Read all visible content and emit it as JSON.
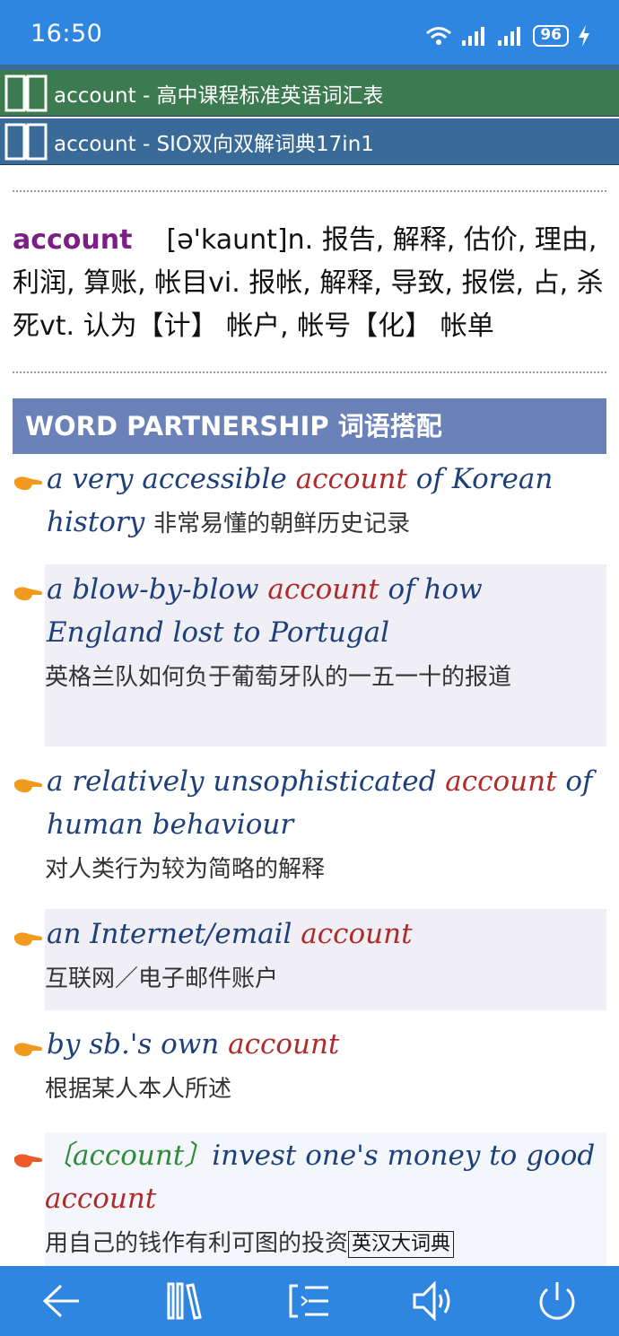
{
  "status": {
    "time": "16:50",
    "battery": "96"
  },
  "sources": [
    {
      "label": "account - 高中课程标准英语词汇表",
      "color": "#3c7a50"
    },
    {
      "label": "account - SIO双向双解词典17in1",
      "color": "#3a6b98"
    }
  ],
  "entry": {
    "headword": "account",
    "definition": "[ə'kaunt]n. 报告, 解释, 估价, 理由, 利润, 算账, 帐目vi. 报帐, 解释, 导致, 报偿, 占, 杀死vt. 认为【计】 帐户, 帐号【化】 帐单"
  },
  "section_title": "WORD PARTNERSHIP 词语搭配",
  "examples": [
    {
      "pre": "a very accessible ",
      "kw": "account",
      "post": " of Korean history",
      "cn": "非常易懂的朝鲜历史记录"
    },
    {
      "pre": "a blow-by-blow ",
      "kw": "account",
      "post": " of how England lost to Portugal",
      "cn": "英格兰队如何负于葡萄牙队的一五一十的报道"
    },
    {
      "pre": "a relatively unsophisticated ",
      "kw": "account",
      "post": " of human behaviour",
      "cn": "对人类行为较为简略的解释"
    },
    {
      "pre": "an Internet/email ",
      "kw": "account",
      "post": "",
      "cn": "互联网／电子邮件账户"
    },
    {
      "pre": "by sb.'s own ",
      "kw": "account",
      "post": "",
      "cn": "根据某人本人所述"
    },
    {
      "tag": "〔account〕",
      "pre": "invest one's money to good ",
      "kw": "account",
      "cn": "用自己的钱作有利可图的投资",
      "source": "英汉大词典"
    }
  ],
  "nav": {
    "icons": [
      "back-arrow-icon",
      "library-icon",
      "list-icon",
      "speaker-icon",
      "power-icon"
    ]
  },
  "colors": {
    "statusbar": "#2f86e0",
    "keyword": "#b02a2a",
    "english": "#1d3f7a",
    "headword": "#7a1f83"
  }
}
